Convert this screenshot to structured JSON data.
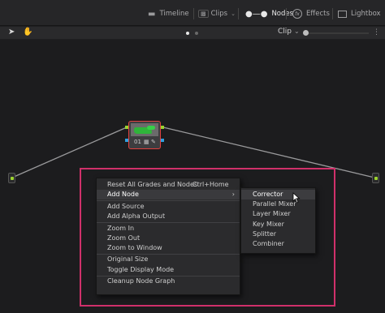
{
  "toolbar": {
    "timeline_label": "Timeline",
    "clips_label": "Clips",
    "nodes_label": "Nodes",
    "effects_label": "Effects",
    "lightbox_label": "Lightbox",
    "icons": [
      "timeline-icon",
      "clips-icon",
      "nodes-icon",
      "effects-icon",
      "lightbox-icon"
    ]
  },
  "subbar": {
    "clip_label": "Clip",
    "tools": [
      "pointer-tool-icon",
      "hand-tool-icon"
    ]
  },
  "node": {
    "number": "01",
    "selection_color": "#e04040"
  },
  "context_menu": {
    "items": [
      {
        "label": "Reset All Grades and Nodes",
        "shortcut": "Ctrl+Home"
      },
      {
        "label": "Add Node",
        "has_submenu": true,
        "highlighted": true
      },
      {
        "label": "Add Source"
      },
      {
        "label": "Add Alpha Output"
      },
      {
        "label": "Zoom In"
      },
      {
        "label": "Zoom Out"
      },
      {
        "label": "Zoom to Window"
      },
      {
        "label": "Original Size"
      },
      {
        "label": "Toggle Display Mode"
      },
      {
        "label": "Cleanup Node Graph"
      }
    ]
  },
  "submenu": {
    "items": [
      "Corrector",
      "Parallel Mixer",
      "Layer Mixer",
      "Key Mixer",
      "Splitter",
      "Combiner"
    ],
    "highlighted": "Corrector"
  },
  "colors": {
    "highlight_frame": "#d0306a",
    "pin_green": "#9bd22f",
    "output_blue": "#2fa0e0"
  }
}
